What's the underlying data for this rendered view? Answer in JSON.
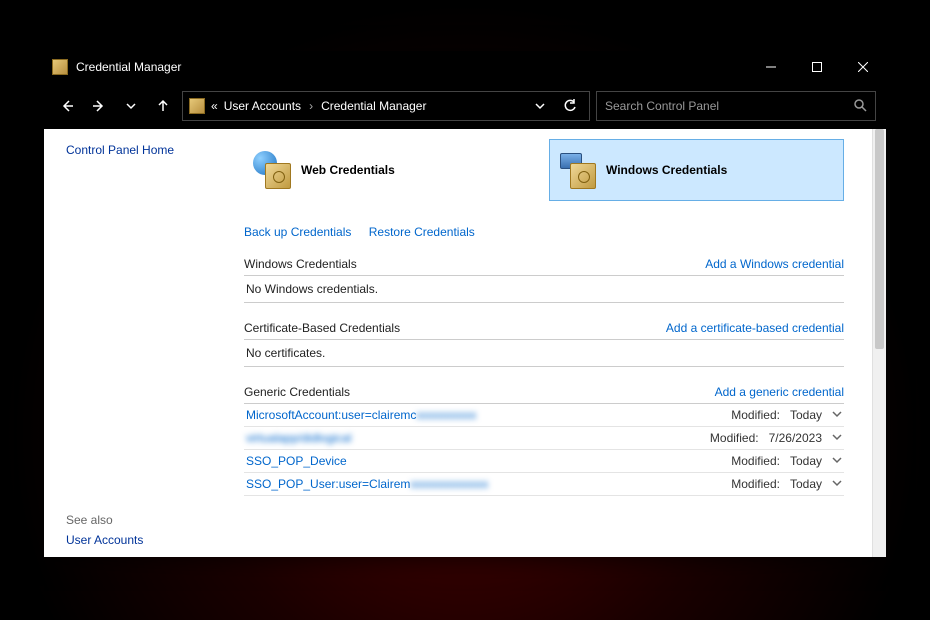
{
  "window": {
    "title": "Credential Manager"
  },
  "breadcrumb": {
    "prefix": "«",
    "item1": "User Accounts",
    "item2": "Credential Manager"
  },
  "search": {
    "placeholder": "Search Control Panel"
  },
  "sidebar": {
    "home": "Control Panel Home",
    "see_also_label": "See also",
    "user_accounts": "User Accounts"
  },
  "tabs": {
    "web": "Web Credentials",
    "windows": "Windows Credentials"
  },
  "actions": {
    "backup": "Back up Credentials",
    "restore": "Restore Credentials"
  },
  "sections": {
    "windows": {
      "title": "Windows Credentials",
      "add_link": "Add a Windows credential",
      "empty": "No Windows credentials."
    },
    "cert": {
      "title": "Certificate-Based Credentials",
      "add_link": "Add a certificate-based credential",
      "empty": "No certificates."
    },
    "generic": {
      "title": "Generic Credentials",
      "add_link": "Add a generic credential"
    }
  },
  "modified_label": "Modified:",
  "generic_items": [
    {
      "name_prefix": "MicrosoftAccount:user=clairemc",
      "name_blur": "xxxxxxxxxx",
      "modified": "Today"
    },
    {
      "name_prefix": "virtualapp/didlogical",
      "name_blur": "",
      "full_blur": true,
      "modified": "7/26/2023"
    },
    {
      "name_prefix": "SSO_POP_Device",
      "name_blur": "",
      "modified": "Today"
    },
    {
      "name_prefix": "SSO_POP_User:user=Clairem",
      "name_blur": "xxxxxxxxxxxxx",
      "modified": "Today"
    }
  ]
}
